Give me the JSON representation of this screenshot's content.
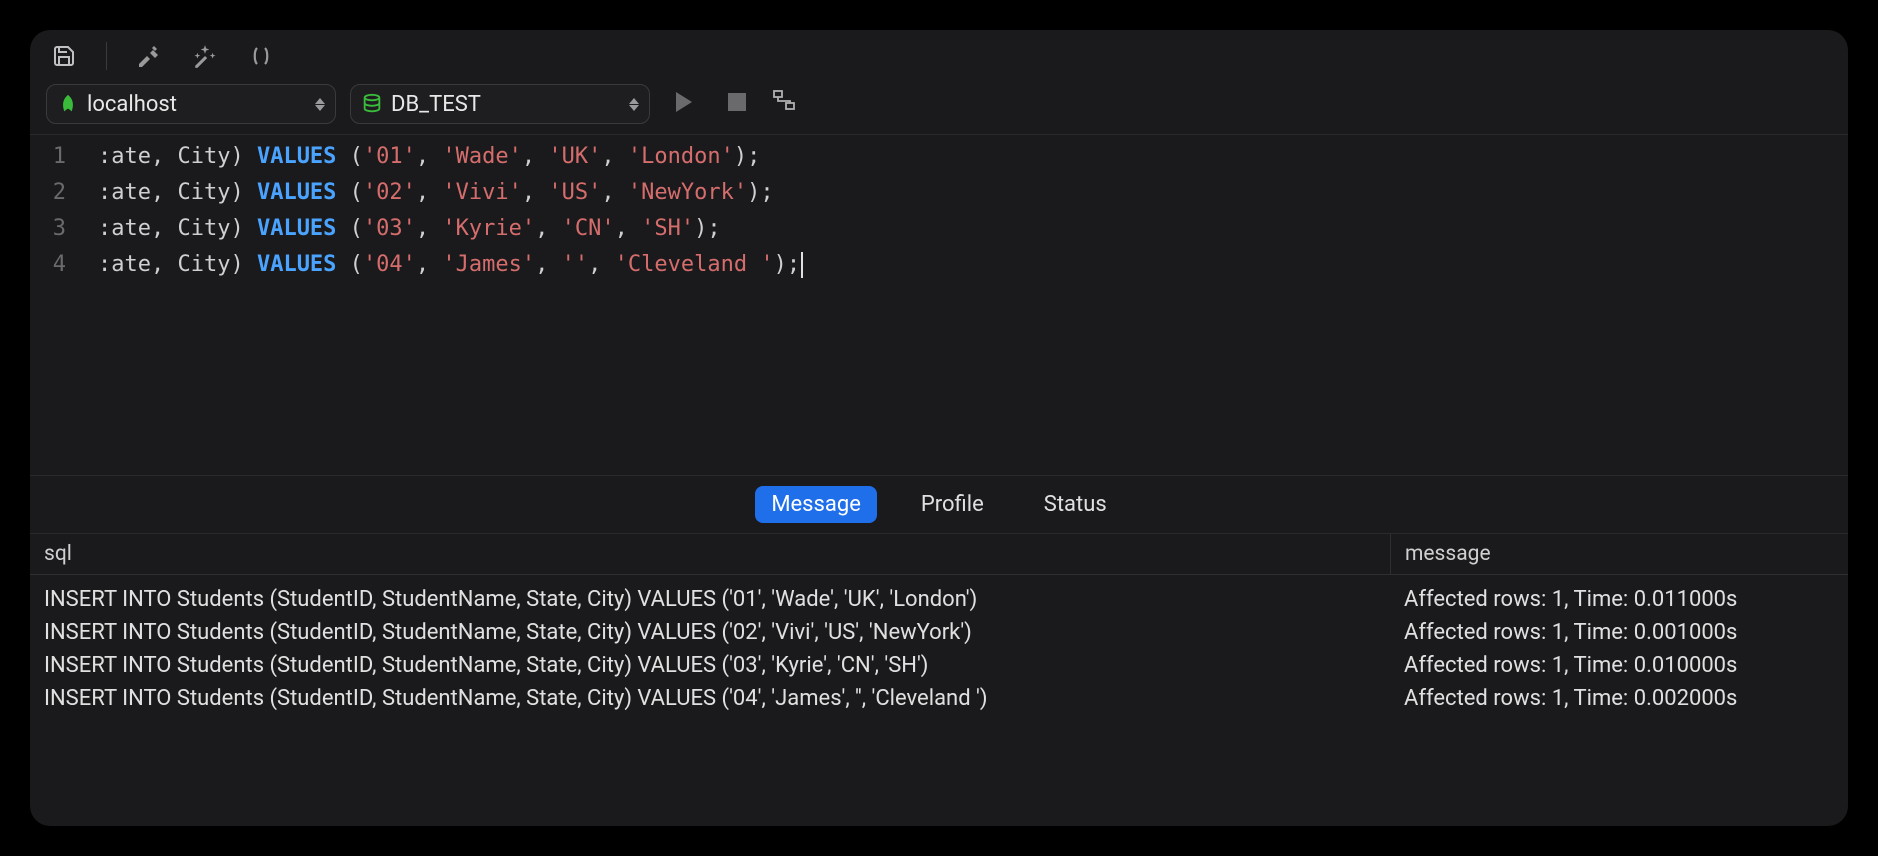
{
  "toolbar": {
    "icons": [
      "save-icon",
      "hammer-icon",
      "magic-wand-icon",
      "parentheses-icon"
    ]
  },
  "connection": {
    "host": "localhost",
    "database": "DB_TEST"
  },
  "editor": {
    "lines": [
      {
        "num": "1",
        "prefix": ":ate, City) ",
        "values": [
          "'01'",
          "'Wade'",
          "'UK'",
          "'London'"
        ]
      },
      {
        "num": "2",
        "prefix": ":ate, City) ",
        "values": [
          "'02'",
          "'Vivi'",
          "'US'",
          "'NewYork'"
        ]
      },
      {
        "num": "3",
        "prefix": ":ate, City) ",
        "values": [
          "'03'",
          "'Kyrie'",
          "'CN'",
          "'SH'"
        ]
      },
      {
        "num": "4",
        "prefix": ":ate, City) ",
        "values": [
          "'04'",
          "'James'",
          "''",
          "'Cleveland '"
        ]
      }
    ],
    "keyword": "VALUES"
  },
  "tabs": {
    "items": [
      {
        "label": "Message",
        "active": true
      },
      {
        "label": "Profile",
        "active": false
      },
      {
        "label": "Status",
        "active": false
      }
    ]
  },
  "results": {
    "headers": {
      "sql": "sql",
      "message": "message"
    },
    "rows": [
      {
        "sql": "INSERT INTO Students (StudentID, StudentName, State, City) VALUES ('01', 'Wade', 'UK', 'London')",
        "message": "Affected rows: 1, Time: 0.011000s"
      },
      {
        "sql": "INSERT INTO Students (StudentID, StudentName, State, City) VALUES ('02', 'Vivi', 'US', 'NewYork')",
        "message": "Affected rows: 1, Time: 0.001000s"
      },
      {
        "sql": "INSERT INTO Students (StudentID, StudentName, State, City) VALUES ('03', 'Kyrie', 'CN', 'SH')",
        "message": "Affected rows: 1, Time: 0.010000s"
      },
      {
        "sql": "INSERT INTO Students (StudentID, StudentName, State, City) VALUES ('04', 'James', '', 'Cleveland ')",
        "message": "Affected rows: 1, Time: 0.002000s"
      }
    ]
  }
}
